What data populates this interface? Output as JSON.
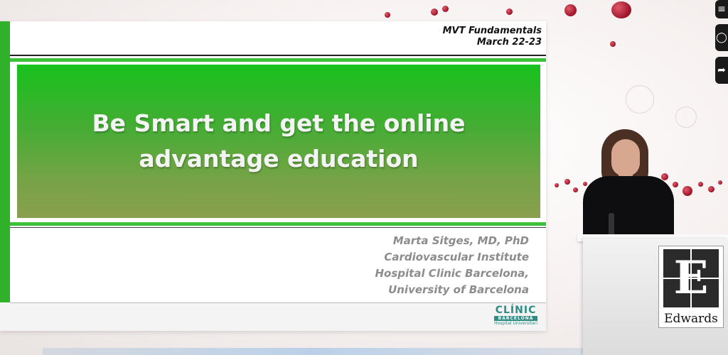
{
  "slide": {
    "header_line1": "MVT Fundamentals",
    "header_line2": "March 22-23",
    "title": "Be Smart and get the online advantage education",
    "author": {
      "name": "Marta Sitges, MD, PhD",
      "line2": "Cardiovascular Institute",
      "line3": "Hospital Clinic Barcelona,",
      "line4": "University of Barcelona"
    },
    "logo": {
      "name": "CLÍNIC",
      "sub": "BARCELONA",
      "sub2": "Hospital Universitari"
    }
  },
  "podium": {
    "brand_letter": "E",
    "brand_name": "Edwards"
  },
  "side_controls": [
    {
      "icon": "menu-icon"
    },
    {
      "icon": "circle-icon"
    },
    {
      "icon": "share-icon"
    }
  ],
  "colors": {
    "slide_green": "#2fb12a",
    "banner_green": "#18c21c",
    "author_gray": "#8c8c8c",
    "clinic_teal": "#2e8c84"
  }
}
